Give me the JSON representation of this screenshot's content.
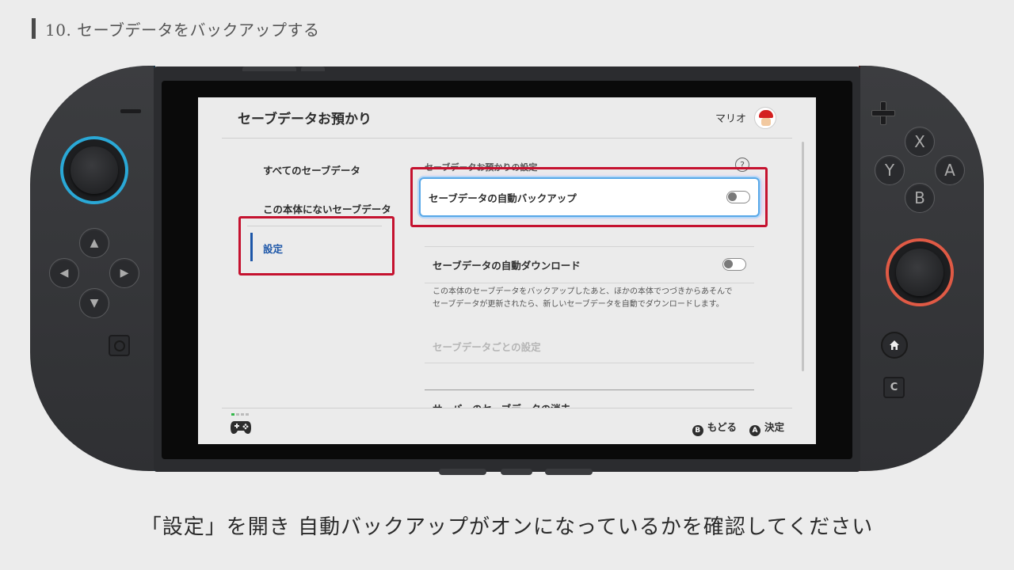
{
  "step_heading": "10. セーブデータをバックアップする",
  "screen": {
    "title": "セーブデータお預かり",
    "user_name": "マリオ",
    "nav": {
      "all": "すべてのセーブデータ",
      "not_on_device": "この本体にないセーブデータ",
      "settings": "設定"
    },
    "section_title": "セーブデータお預かりの設定",
    "help_symbol": "?",
    "auto_backup": {
      "label": "セーブデータの自動バックアップ",
      "on": false
    },
    "auto_download": {
      "label": "セーブデータの自動ダウンロード",
      "on": false
    },
    "description_line1": "この本体のセーブデータをバックアップしたあと、ほかの本体でつづきからあそんで",
    "description_line2": "セーブデータが更新されたら、新しいセーブデータを自動でダウンロードします。",
    "per_data_settings": "セーブデータごとの設定",
    "server_delete": "サーバーのセーブデータの消去",
    "footer": {
      "b_glyph": "B",
      "b_label": "もどる",
      "a_glyph": "A",
      "a_label": "決定"
    }
  },
  "console_buttons": {
    "x": "X",
    "y": "Y",
    "a": "A",
    "b": "B",
    "c": "C",
    "up": "▲",
    "down": "▼",
    "left": "◀",
    "right": "▶"
  },
  "caption": "「設定」を開き 自動バックアップがオンになっているかを確認してください",
  "colors": {
    "callout": "#c5122f",
    "selected_nav": "#1c56a8",
    "left_stick_ring": "#2aa8d6",
    "right_stick_ring": "#e05a45"
  }
}
